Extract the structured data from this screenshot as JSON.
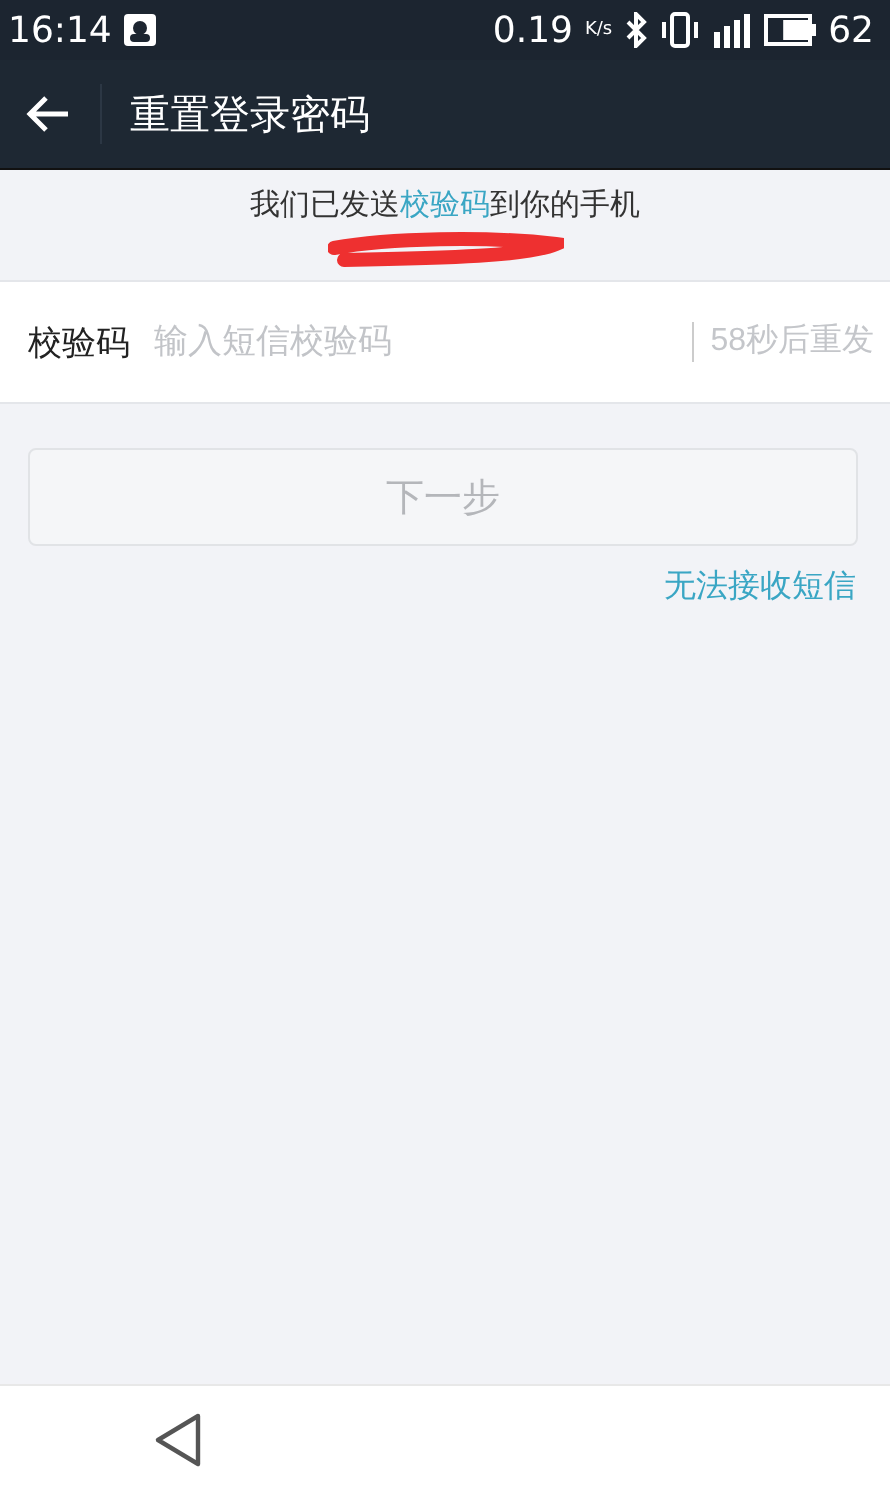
{
  "status_bar": {
    "time": "16:14",
    "speed": "0.19",
    "speed_unit": "K/s",
    "battery": "62"
  },
  "header": {
    "title": "重置登录密码"
  },
  "notice": {
    "text": "我们已发送**校验码**到你的手机"
  },
  "code_field": {
    "label": "校验码",
    "placeholder": "输入短信校验码",
    "resend": "58秒后重发",
    "resend_disabled": true
  },
  "next_button": {
    "label": "下一步",
    "disabled": true
  },
  "help_link": "无法接收短信"
}
